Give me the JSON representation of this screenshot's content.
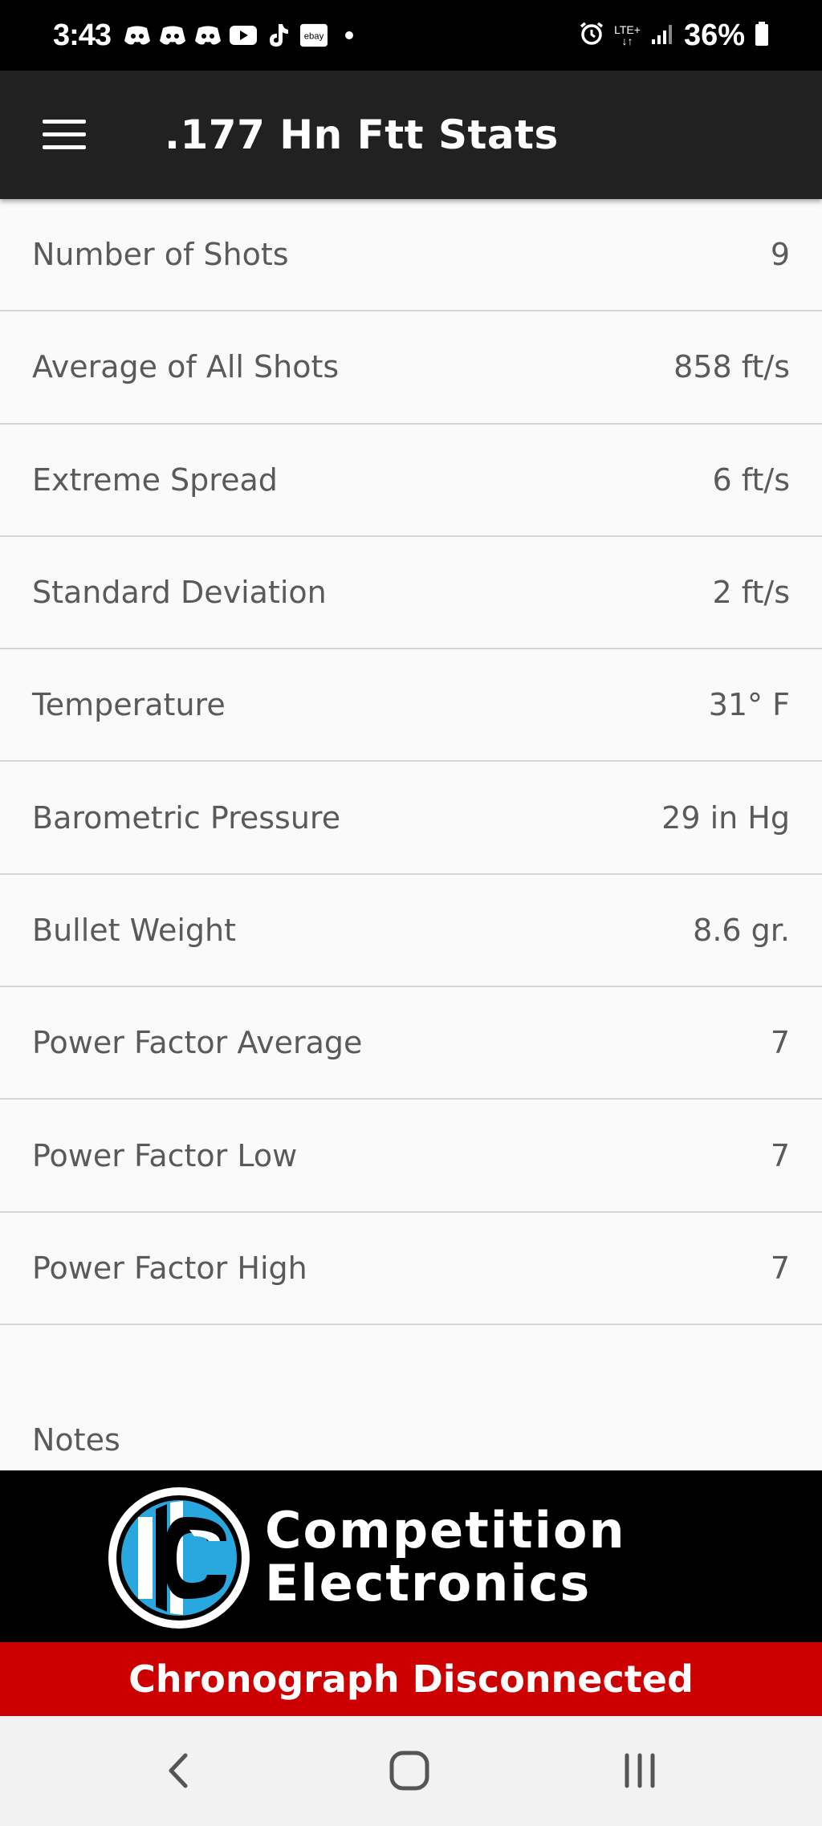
{
  "status_bar": {
    "time": "3:43",
    "notifications": [
      "discord-icon",
      "discord-icon",
      "discord-icon",
      "youtube-icon",
      "tiktok-icon",
      "ebay-icon",
      "dot-icon"
    ],
    "ebay_label": "ebay",
    "network": "LTE+",
    "battery": "36%"
  },
  "app_bar": {
    "title": ".177 Hn Ftt Stats",
    "menu_icon": "hamburger-menu-icon"
  },
  "stats": [
    {
      "label": "Number of Shots",
      "value": "9"
    },
    {
      "label": "Average of All Shots",
      "value": "858 ft/s"
    },
    {
      "label": "Extreme Spread",
      "value": "6 ft/s"
    },
    {
      "label": "Standard Deviation",
      "value": "2 ft/s"
    },
    {
      "label": "Temperature",
      "value": "31° F"
    },
    {
      "label": "Barometric Pressure",
      "value": "29 in Hg"
    },
    {
      "label": "Bullet Weight",
      "value": "8.6 gr."
    },
    {
      "label": "Power Factor Average",
      "value": "7"
    },
    {
      "label": "Power Factor Low",
      "value": "7"
    },
    {
      "label": "Power Factor High",
      "value": "7"
    }
  ],
  "notes_label": "Notes",
  "brand": {
    "line1": "Competition",
    "line2": "Electronics"
  },
  "connection_status": "Chronograph Disconnected",
  "colors": {
    "app_bar": "#212121",
    "status_bar": "#000000",
    "disconnected": "#cc0000",
    "text": "#5a5a5a"
  },
  "nav": {
    "back_icon": "back-chevron-icon",
    "home_icon": "home-icon",
    "recents_icon": "recents-icon"
  }
}
